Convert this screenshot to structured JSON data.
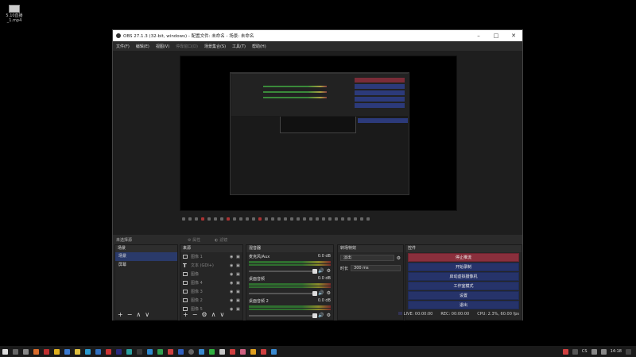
{
  "desktop": {
    "file_icon_label": "5.10直播_1.mp4"
  },
  "window": {
    "title": "OBS 27.1.3 (32-bit, windows) - 配置文件: 未命名 - 场景: 未命名",
    "minimize": "–",
    "maximize": "□",
    "close": "✕"
  },
  "menubar": {
    "items": [
      "文件(F)",
      "编辑(E)",
      "视图(V)",
      "停靠窗口(D)",
      "场景集合(S)",
      "工具(T)",
      "帮助(H)"
    ]
  },
  "scene_bar": {
    "no_source": "未选择源",
    "properties": "属性",
    "filters": "滤镜"
  },
  "scenes": {
    "header": "场景",
    "items": [
      "场景",
      "屏幕"
    ],
    "selected_index": 0
  },
  "sources": {
    "header": "来源",
    "items": [
      {
        "label": "图像 1",
        "type": "image"
      },
      {
        "label": "文本 (GDI+)",
        "type": "text"
      },
      {
        "label": "图像",
        "type": "image"
      },
      {
        "label": "图像 4",
        "type": "image"
      },
      {
        "label": "图像 3",
        "type": "image"
      },
      {
        "label": "图像 2",
        "type": "image"
      },
      {
        "label": "图像 5",
        "type": "image"
      }
    ]
  },
  "mixer": {
    "header": "混音器",
    "tracks": [
      {
        "name": "麦克风/Aux",
        "db": "0.0 dB"
      },
      {
        "name": "桌面音频",
        "db": "0.0 dB"
      },
      {
        "name": "桌面音频 2",
        "db": "0.0 dB"
      }
    ]
  },
  "transitions": {
    "header": "转场特效",
    "selected": "淡出",
    "duration_label": "时长",
    "duration_value": "300 ms"
  },
  "controls": {
    "header": "控件",
    "buttons": [
      "停止推流",
      "开始录制",
      "启动虚拟摄像机",
      "工作室模式",
      "设置",
      "退出"
    ]
  },
  "statusbar": {
    "live": "LIVE: 00:00:00",
    "rec": "REC: 00:00:00",
    "cpu": "CPU: 2.3%, 60.00 fps"
  },
  "taskbar": {
    "time": "14:18",
    "lang": "CS"
  },
  "colors": {
    "stop_stream_button": "#8a2f3c",
    "control_button": "#26336a",
    "selected_scene": "#2a3a6a"
  }
}
